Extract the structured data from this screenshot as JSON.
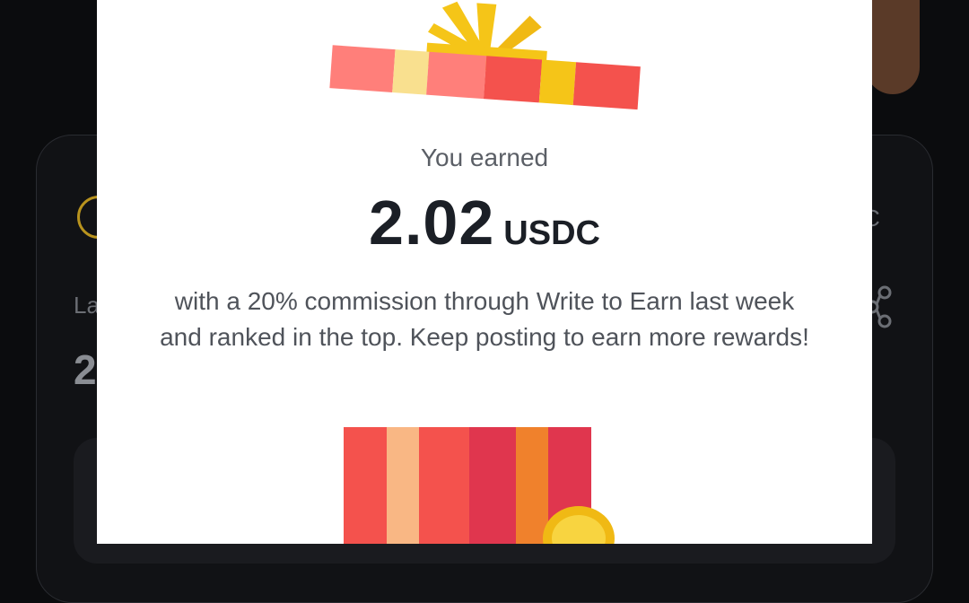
{
  "background": {
    "label_fragment": "La",
    "value_fragment": "2",
    "currency_fragment": "C",
    "icons": [
      "coin-icon",
      "share-icon"
    ]
  },
  "modal": {
    "earned_label": "You earned",
    "amount": "2.02",
    "currency": "USDC",
    "message": "with a 20% commission through Write to Earn last week and ranked in the top. Keep posting to earn more rewards!",
    "illustrations": [
      "gift-lid-illustration",
      "gift-box-illustration",
      "coin-icon"
    ]
  },
  "colors": {
    "gift_red": "#f4524d",
    "gift_pink": "#ff7f7a",
    "gift_yellow": "#f5c518",
    "amount_text": "#1b1f26"
  }
}
